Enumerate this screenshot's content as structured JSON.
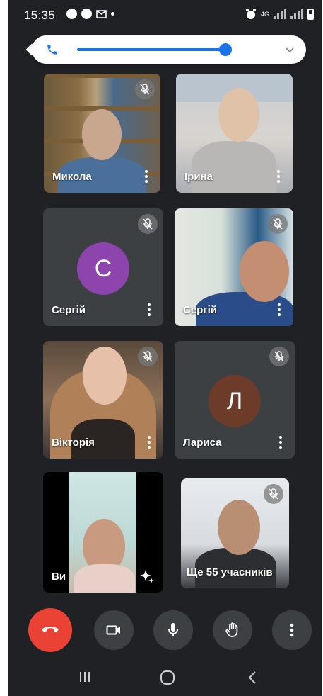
{
  "status_bar": {
    "time": "15:35",
    "network": "4G"
  },
  "volume_panel": {
    "level_percent": 75,
    "accent_color": "#1a73e8"
  },
  "participants": [
    {
      "name": "Микола",
      "type": "video",
      "muted": true
    },
    {
      "name": "Ірина",
      "type": "video",
      "muted": false
    },
    {
      "name": "Сергій",
      "type": "avatar",
      "initial": "С",
      "avatar_color": "#8e44ad",
      "muted": true
    },
    {
      "name": "Сергій",
      "type": "video",
      "muted": true
    },
    {
      "name": "Вікторія",
      "type": "video",
      "muted": true
    },
    {
      "name": "Лариса",
      "type": "avatar",
      "initial": "Л",
      "avatar_color": "#6d3b2a",
      "muted": true
    },
    {
      "name": "Ви",
      "type": "self-video",
      "muted": false
    },
    {
      "name": "Ще 55 учасників",
      "type": "video",
      "muted": true
    }
  ],
  "call_controls": {
    "end_color": "#ea4335",
    "button_color": "#3c4043"
  }
}
